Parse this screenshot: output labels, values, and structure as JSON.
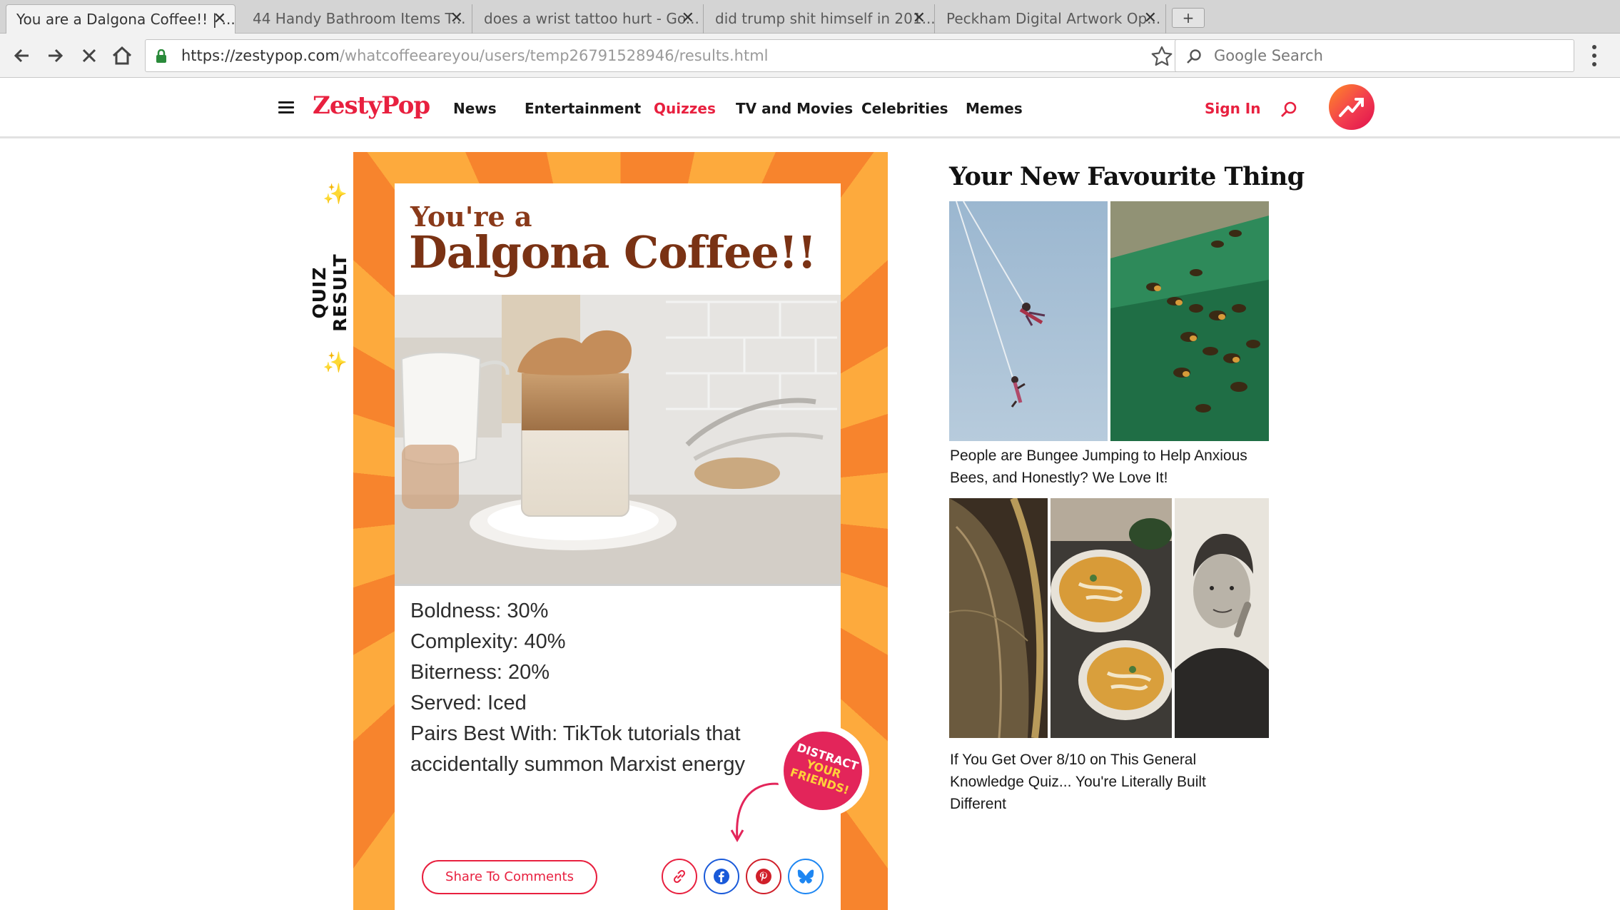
{
  "browser": {
    "tabs": [
      {
        "title": "You are a Dalgona Coffee!! | ...",
        "active": true
      },
      {
        "title": "44 Handy Bathroom Items T...",
        "active": false
      },
      {
        "title": "does a wrist tattoo hurt - Go...",
        "active": false
      },
      {
        "title": "did trump shit himself in 201...",
        "active": false
      },
      {
        "title": "Peckham Digital Artwork Op...",
        "active": false
      }
    ],
    "new_tab_label": "+",
    "tab_close_glyph": "✕",
    "url_host": "https://zestypop.com",
    "url_path": "/whatcoffeeareyou/users/temp26791528946/results.html",
    "search_placeholder": "Google Search"
  },
  "site": {
    "logo": "ZestyPop",
    "brand_color": "#e8203f",
    "nav": [
      "News",
      "Entertainment",
      "Quizzes",
      "TV and Movies",
      "Celebrities",
      "Memes"
    ],
    "active_nav": "Quizzes",
    "sign_in": "Sign In"
  },
  "quiz": {
    "side_label": "QUIZ RESULT",
    "sparkle": "✨",
    "title_small": "You're a",
    "title_big": "Dalgona Coffee!!",
    "stats": [
      "Boldness: 30%",
      "Complexity: 40%",
      "Biterness: 20%",
      "Served: Iced",
      "Pairs Best With: TikTok tutorials that accidentally summon Marxist energy"
    ],
    "distract": [
      "DISTRACT",
      "YOUR",
      "FRIENDS!"
    ],
    "share_label": "Share To Comments",
    "share_icons": [
      "link-icon",
      "facebook-icon",
      "pinterest-icon",
      "bluesky-icon"
    ]
  },
  "sidebar": {
    "title": "Your New Favourite Thing",
    "articles": [
      {
        "caption": "People are Bungee Jumping to Help Anxious Bees, and Honestly? We Love It!"
      },
      {
        "caption": "If You Get Over 8/10 on This General Knowledge Quiz... You're Literally Built Different"
      }
    ]
  }
}
